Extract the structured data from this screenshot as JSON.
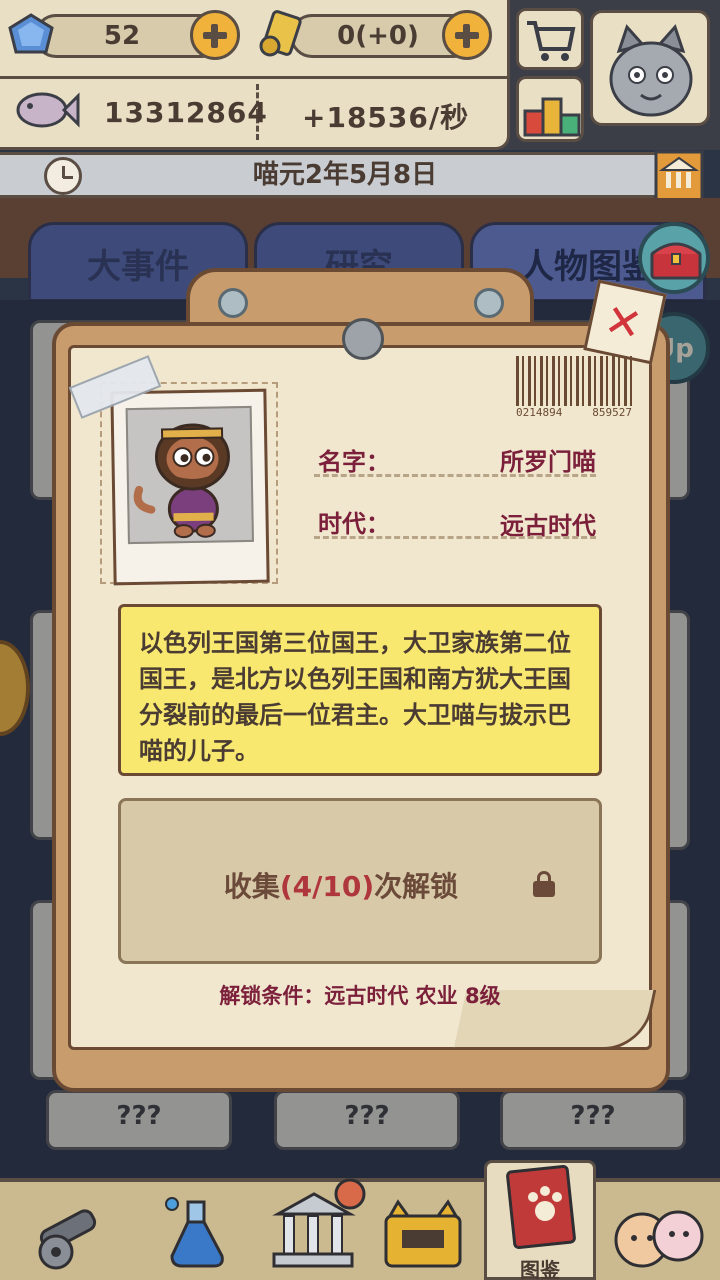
{
  "resources": {
    "gems": "52",
    "scrolls": "0(+0)",
    "fish": "13312864",
    "fish_rate": "+18536/秒"
  },
  "date": "喵元2年5月8日",
  "tabs": [
    "大事件",
    "研究",
    "人物图鉴"
  ],
  "locked_placeholder": "???",
  "card": {
    "name_label": "名字：",
    "name_value": "所罗门喵",
    "era_label": "时代：",
    "era_value": "远古时代",
    "barcode_left": "0214894",
    "barcode_right": "859527",
    "description": "以色列王国第三位国王，大卫家族第二位国王，是北方以色列王国和南方犹大王国分裂前的最后一位君主。大卫喵与拔示巴喵的儿子。",
    "unlock_prefix": "收集",
    "unlock_progress": "(4/10)",
    "unlock_suffix": "次解锁",
    "unlock_condition": "解锁条件：远古时代 农业 8级"
  },
  "float_button_label": "Up",
  "bottom_nav": {
    "active_label": "图鉴"
  },
  "icons": [
    "gem-icon",
    "plus-icon",
    "scroll-icon",
    "fish-icon",
    "cart-icon",
    "podium-icon",
    "avatar-cat",
    "clock-icon",
    "bank-icon",
    "chest-icon",
    "up-icon",
    "close-icon",
    "lock-icon",
    "cannon-icon",
    "potion-icon",
    "temple-icon",
    "cat-box-icon",
    "book-icon",
    "cats-icon",
    "coin-icon"
  ],
  "colors": {
    "accent_yellow": "#f8e870",
    "unlock_red": "#b0363e",
    "label_crimson": "#7b1f3a",
    "close_red": "#d2343c"
  }
}
